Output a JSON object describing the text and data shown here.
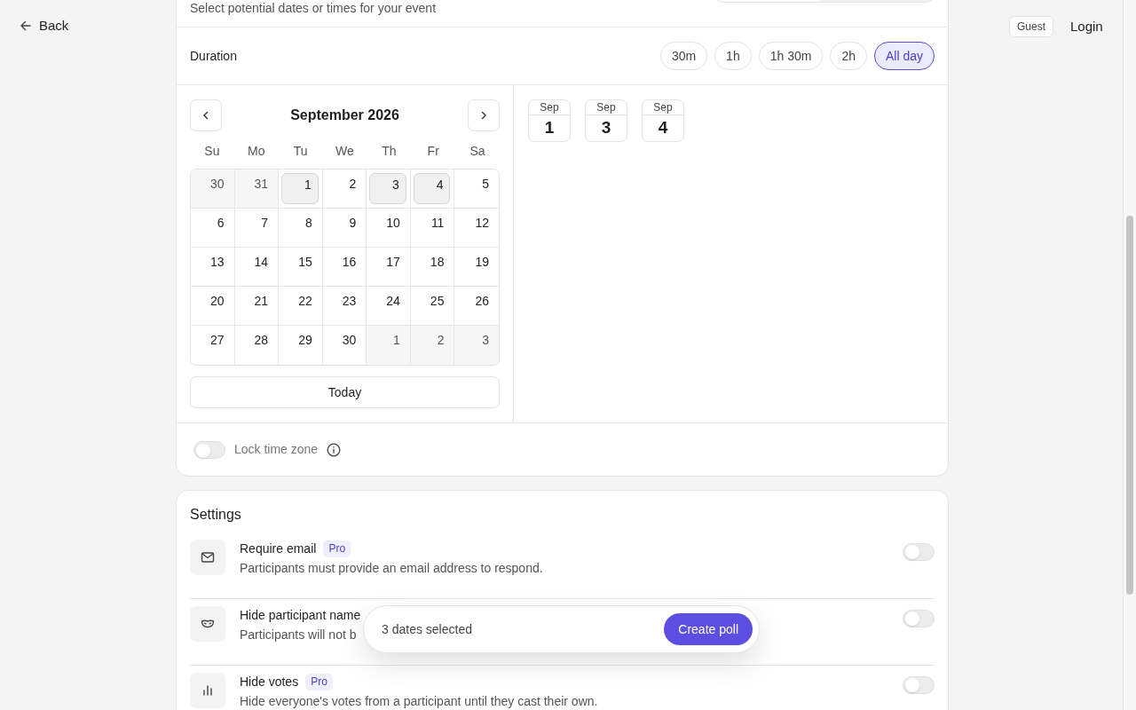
{
  "back": "Back",
  "user_badge": "Guest",
  "login": "Login",
  "poll": {
    "subtitle": "Select potential dates or times for your event",
    "duration": {
      "label": "Duration",
      "options": [
        {
          "label": "30m",
          "selected": false
        },
        {
          "label": "1h",
          "selected": false
        },
        {
          "label": "1h 30m",
          "selected": false
        },
        {
          "label": "2h",
          "selected": false
        },
        {
          "label": "All day",
          "selected": true
        }
      ]
    },
    "calendar": {
      "month": "September 2026",
      "weekdays": [
        "Su",
        "Mo",
        "Tu",
        "We",
        "Th",
        "Fr",
        "Sa"
      ],
      "days": [
        {
          "label": "30",
          "outside": true,
          "selected": false
        },
        {
          "label": "31",
          "outside": true,
          "selected": false
        },
        {
          "label": "1",
          "outside": false,
          "selected": true
        },
        {
          "label": "2",
          "outside": false,
          "selected": false
        },
        {
          "label": "3",
          "outside": false,
          "selected": true
        },
        {
          "label": "4",
          "outside": false,
          "selected": true
        },
        {
          "label": "5",
          "outside": false,
          "selected": false
        },
        {
          "label": "6",
          "outside": false,
          "selected": false
        },
        {
          "label": "7",
          "outside": false,
          "selected": false
        },
        {
          "label": "8",
          "outside": false,
          "selected": false
        },
        {
          "label": "9",
          "outside": false,
          "selected": false
        },
        {
          "label": "10",
          "outside": false,
          "selected": false
        },
        {
          "label": "11",
          "outside": false,
          "selected": false
        },
        {
          "label": "12",
          "outside": false,
          "selected": false
        },
        {
          "label": "13",
          "outside": false,
          "selected": false
        },
        {
          "label": "14",
          "outside": false,
          "selected": false
        },
        {
          "label": "15",
          "outside": false,
          "selected": false
        },
        {
          "label": "16",
          "outside": false,
          "selected": false
        },
        {
          "label": "17",
          "outside": false,
          "selected": false
        },
        {
          "label": "18",
          "outside": false,
          "selected": false
        },
        {
          "label": "19",
          "outside": false,
          "selected": false
        },
        {
          "label": "20",
          "outside": false,
          "selected": false
        },
        {
          "label": "21",
          "outside": false,
          "selected": false
        },
        {
          "label": "22",
          "outside": false,
          "selected": false
        },
        {
          "label": "23",
          "outside": false,
          "selected": false
        },
        {
          "label": "24",
          "outside": false,
          "selected": false
        },
        {
          "label": "25",
          "outside": false,
          "selected": false
        },
        {
          "label": "26",
          "outside": false,
          "selected": false
        },
        {
          "label": "27",
          "outside": false,
          "selected": false
        },
        {
          "label": "28",
          "outside": false,
          "selected": false
        },
        {
          "label": "29",
          "outside": false,
          "selected": false
        },
        {
          "label": "30",
          "outside": false,
          "selected": false
        },
        {
          "label": "1",
          "outside": true,
          "selected": false
        },
        {
          "label": "2",
          "outside": true,
          "selected": false
        },
        {
          "label": "3",
          "outside": true,
          "selected": false
        }
      ],
      "today": "Today"
    },
    "selected_dates": [
      {
        "month": "Sep",
        "day": "1"
      },
      {
        "month": "Sep",
        "day": "3"
      },
      {
        "month": "Sep",
        "day": "4"
      }
    ],
    "lock_time_zone": {
      "label": "Lock time zone",
      "on": false
    }
  },
  "settings": {
    "title": "Settings",
    "items": [
      {
        "title": "Require email",
        "badge": "Pro",
        "description": "Participants must provide an email address to respond.",
        "on": false
      },
      {
        "title": "Hide participant name",
        "description": "Participants will not b",
        "on": false
      },
      {
        "title": "Hide votes",
        "badge": "Pro",
        "description": "Hide everyone's votes from a participant until they cast their own.",
        "on": false
      }
    ]
  },
  "selection_bar": {
    "text": "3 dates selected",
    "button": "Create poll"
  }
}
